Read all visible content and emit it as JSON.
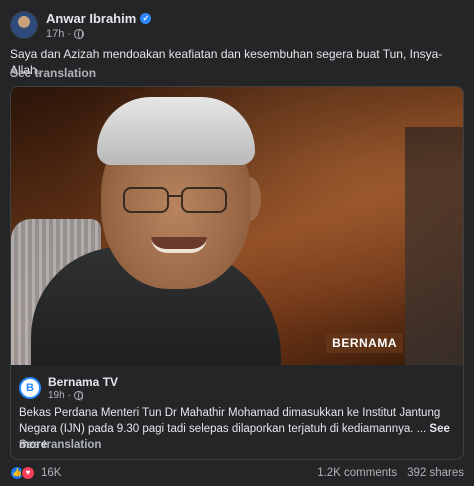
{
  "post": {
    "author": "Anwar Ibrahim",
    "time": "17h",
    "caption": "Saya dan Azizah mendoakan keafiatan dan kesembuhan segera buat Tun, Insya-Allah.",
    "see_translation": "See translation"
  },
  "shared": {
    "watermark": "BERNAMA",
    "source_name": "Bernama TV",
    "source_time": "19h",
    "text": "Bekas Perdana Menteri Tun Dr Mahathir Mohamad dimasukkan ke Institut Jantung Negara (IJN) pada 9.30 pagi tadi selepas dilaporkan terjatuh di kediamannya. ...",
    "see_more": "See more",
    "see_translation": "See translation"
  },
  "footer": {
    "reactions_count": "16K",
    "comments": "1.2K comments",
    "shares": "392 shares"
  },
  "colors": {
    "background": "#242526",
    "text_primary": "#e4e6eb",
    "text_secondary": "#b0b3b8",
    "like_blue": "#1877f2",
    "love_red": "#f33e58",
    "verified_blue": "#2d88ff"
  },
  "icons": [
    "verified-badge-icon",
    "globe-icon",
    "like-reaction-icon",
    "love-reaction-icon"
  ]
}
